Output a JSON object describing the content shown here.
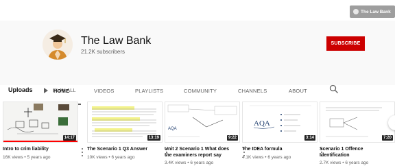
{
  "brand_pill": {
    "label": "The Law Bank"
  },
  "channel": {
    "name": "The Law Bank",
    "subscribers": "21.2K subscribers",
    "subscribe_label": "SUBSCRIBE"
  },
  "tabs": [
    {
      "label": "HOME",
      "active": true
    },
    {
      "label": "VIDEOS"
    },
    {
      "label": "PLAYLISTS"
    },
    {
      "label": "COMMUNITY"
    },
    {
      "label": "CHANNELS"
    },
    {
      "label": "ABOUT"
    }
  ],
  "uploads": {
    "label": "Uploads",
    "play_all": "PLAY ALL"
  },
  "videos": [
    {
      "title": "Intro to crim liability",
      "meta": "16K views • 5 years ago",
      "duration": "14:17",
      "watched": 1.0
    },
    {
      "title": "The Scenario 1 Q3 Answer",
      "meta": "10K views • 6 years ago",
      "duration": "13:19"
    },
    {
      "title": "Unit 2 Scenario 1 What does the examiners report say",
      "meta": "3.4K views • 6 years ago",
      "duration": "9:22"
    },
    {
      "title": "The IDEA formula",
      "meta": "4.1K views • 6 years ago",
      "duration": "3:14"
    },
    {
      "title": "Scenario 1 Offence Identification",
      "meta": "2.7K views • 6 years ago",
      "duration": "7:20"
    }
  ],
  "colors": {
    "accent": "#cc0000",
    "progress": "#ff0000"
  },
  "icons": {
    "search": "search-icon",
    "next": "chevron-right-icon",
    "play": "play-icon"
  }
}
